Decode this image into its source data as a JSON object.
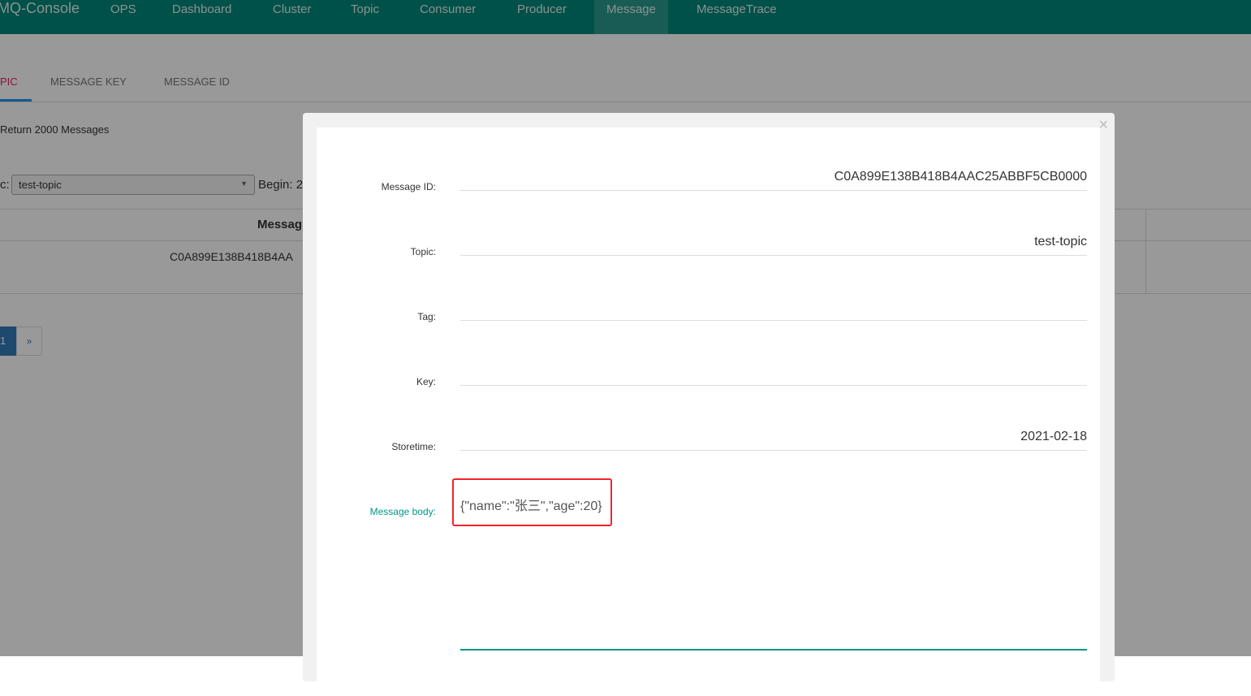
{
  "nav": {
    "brand": "MQ-Console",
    "items": [
      "OPS",
      "Dashboard",
      "Cluster",
      "Topic",
      "Consumer",
      "Producer",
      "Message",
      "MessageTrace"
    ],
    "active": "Message"
  },
  "tabs": [
    "PIC",
    "MESSAGE KEY",
    "MESSAGE ID"
  ],
  "info": "Return 2000 Messages",
  "filter": {
    "topic_label": "c:",
    "topic_value": "test-topic",
    "begin_label": "Begin: 2"
  },
  "table": {
    "header": "Messag",
    "row": "C0A899E138B418B4AA"
  },
  "pagination": {
    "current": "1",
    "next": "»"
  },
  "modal": {
    "close": "×",
    "fields": [
      {
        "label": "Message ID:",
        "value": "C0A899E138B418B4AAC25ABBF5CB0000"
      },
      {
        "label": "Topic:",
        "value": "test-topic"
      },
      {
        "label": "Tag:",
        "value": ""
      },
      {
        "label": "Key:",
        "value": ""
      },
      {
        "label": "Storetime:",
        "value": "2021-02-18"
      }
    ],
    "body_label": "Message body:",
    "body_value": "{\"name\":\"张三\",\"age\":20}"
  },
  "colors": {
    "nav": "#00877a",
    "accent": "#009688",
    "highlight": "#f5222d"
  }
}
